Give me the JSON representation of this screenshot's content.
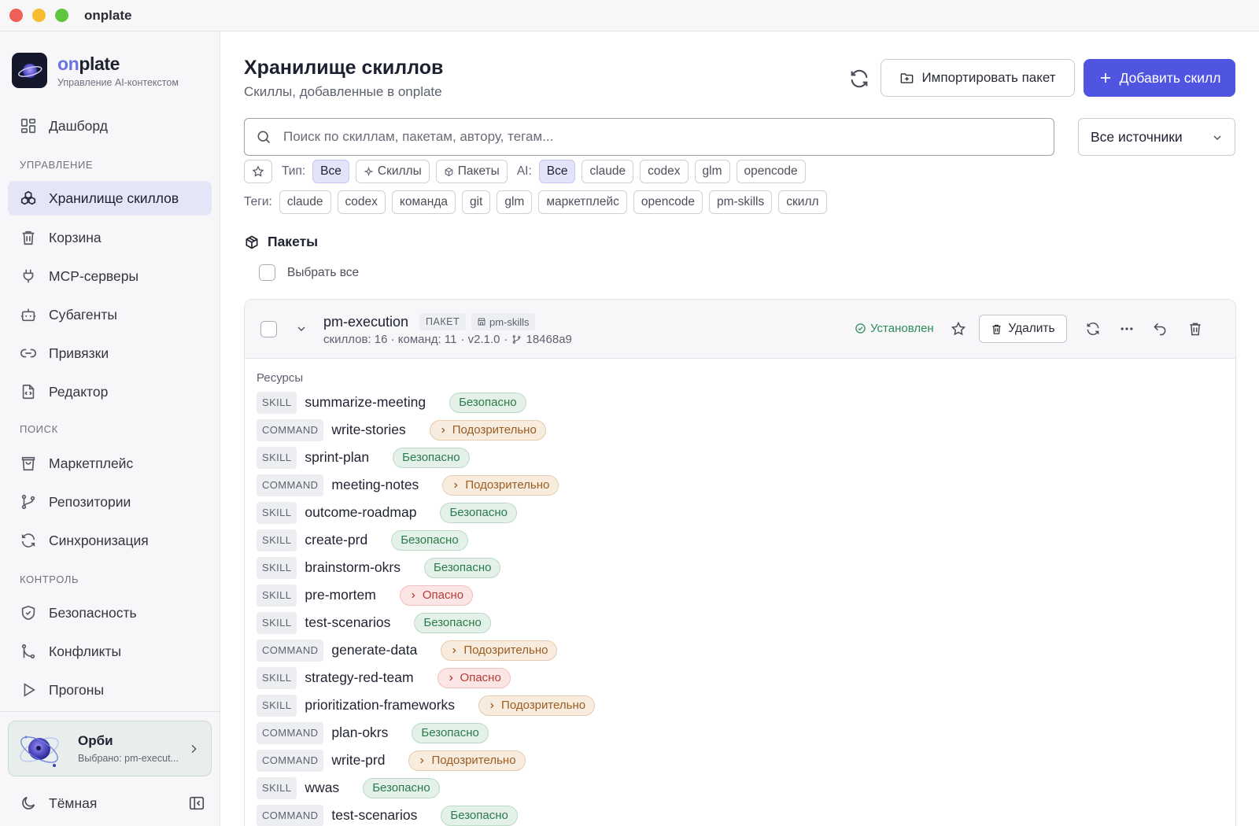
{
  "window": {
    "title": "onplate"
  },
  "brand": {
    "name_accent": "on",
    "name_rest": "plate",
    "subtitle": "Управление AI-контекстом"
  },
  "sidebar": {
    "dashboard": "Дашборд",
    "sections": {
      "manage": "управление",
      "search": "поиск",
      "control": "контроль"
    },
    "items": {
      "skills": "Хранилище скиллов",
      "trash": "Корзина",
      "mcp": "MCP-серверы",
      "subagents": "Субагенты",
      "bindings": "Привязки",
      "editor": "Редактор",
      "marketplace": "Маркетплейс",
      "repos": "Репозитории",
      "sync": "Синхронизация",
      "security": "Безопасность",
      "conflicts": "Конфликты",
      "runs": "Прогоны"
    },
    "orbi": {
      "name": "Орби",
      "subtitle": "Выбрано: pm-execut..."
    },
    "theme": "Тёмная"
  },
  "header": {
    "title": "Хранилище скиллов",
    "subtitle": "Скиллы, добавленные в onplate",
    "import_label": "Импортировать пакет",
    "add_label": "Добавить скилл"
  },
  "search": {
    "placeholder": "Поиск по скиллам, пакетам, автору, тегам...",
    "value": ""
  },
  "source_select": {
    "value": "Все источники"
  },
  "filters": {
    "type_label": "Тип:",
    "types": [
      "Все",
      "Скиллы",
      "Пакеты"
    ],
    "ai_label": "AI:",
    "ai": [
      "Все",
      "claude",
      "codex",
      "glm",
      "opencode"
    ],
    "tags_label": "Теги:",
    "tags": [
      "claude",
      "codex",
      "команда",
      "git",
      "glm",
      "маркетплейс",
      "opencode",
      "pm-skills",
      "скилл"
    ]
  },
  "packages_section": {
    "title": "Пакеты",
    "select_all": "Выбрать все"
  },
  "package": {
    "name": "pm-execution",
    "kind": "ПАКЕТ",
    "source": "pm-skills",
    "meta": "скиллов: 16 · команд: 11",
    "version": "· v2.1.0",
    "commit_sep": "·",
    "commit": "18468a9",
    "status": "Установлен",
    "delete_label": "Удалить",
    "resources_label": "Ресурсы",
    "resources": [
      {
        "type": "SKILL",
        "name": "summarize-meeting",
        "badge": "Безопасно",
        "level": "safe"
      },
      {
        "type": "COMMAND",
        "name": "write-stories",
        "badge": "Подозрительно",
        "level": "susp"
      },
      {
        "type": "SKILL",
        "name": "sprint-plan",
        "badge": "Безопасно",
        "level": "safe"
      },
      {
        "type": "COMMAND",
        "name": "meeting-notes",
        "badge": "Подозрительно",
        "level": "susp"
      },
      {
        "type": "SKILL",
        "name": "outcome-roadmap",
        "badge": "Безопасно",
        "level": "safe"
      },
      {
        "type": "SKILL",
        "name": "create-prd",
        "badge": "Безопасно",
        "level": "safe"
      },
      {
        "type": "SKILL",
        "name": "brainstorm-okrs",
        "badge": "Безопасно",
        "level": "safe"
      },
      {
        "type": "SKILL",
        "name": "pre-mortem",
        "badge": "Опасно",
        "level": "danger"
      },
      {
        "type": "SKILL",
        "name": "test-scenarios",
        "badge": "Безопасно",
        "level": "safe"
      },
      {
        "type": "COMMAND",
        "name": "generate-data",
        "badge": "Подозрительно",
        "level": "susp"
      },
      {
        "type": "SKILL",
        "name": "strategy-red-team",
        "badge": "Опасно",
        "level": "danger"
      },
      {
        "type": "SKILL",
        "name": "prioritization-frameworks",
        "badge": "Подозрительно",
        "level": "susp"
      },
      {
        "type": "COMMAND",
        "name": "plan-okrs",
        "badge": "Безопасно",
        "level": "safe"
      },
      {
        "type": "COMMAND",
        "name": "write-prd",
        "badge": "Подозрительно",
        "level": "susp"
      },
      {
        "type": "SKILL",
        "name": "wwas",
        "badge": "Безопасно",
        "level": "safe"
      },
      {
        "type": "COMMAND",
        "name": "test-scenarios",
        "badge": "Безопасно",
        "level": "safe"
      }
    ]
  },
  "colors": {
    "accent": "#4f55e0",
    "safe": "#2c7a4c",
    "suspicious": "#9b5d20",
    "danger": "#b83a34"
  }
}
